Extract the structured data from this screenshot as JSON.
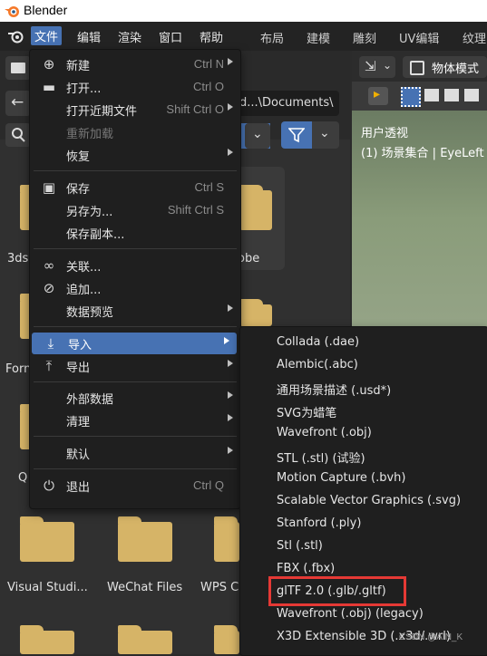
{
  "window": {
    "title": "Blender"
  },
  "menubar": {
    "items": [
      "文件",
      "编辑",
      "渲染",
      "窗口",
      "帮助"
    ],
    "workspaces": [
      "布局",
      "建模",
      "雕刻",
      "UV编辑",
      "纹理"
    ]
  },
  "file_browser": {
    "path": "d...\\Documents\\",
    "items": [
      {
        "label": "3ds"
      },
      {
        "label": "obe"
      },
      {
        "label": "Forn"
      },
      {
        "label": "Q"
      },
      {
        "label": "Visual Studi..."
      },
      {
        "label": "WeChat Files"
      },
      {
        "label": "WPS C"
      }
    ]
  },
  "viewport": {
    "mode": "物体模式",
    "view_label": "用户透视",
    "collection_label": "(1) 场景集合 | EyeLeft"
  },
  "file_menu": {
    "items": [
      {
        "label": "新建",
        "shortcut": "Ctrl N",
        "icon": "new-file-icon",
        "submenu": true
      },
      {
        "label": "打开...",
        "shortcut": "Ctrl O",
        "icon": "folder-icon",
        "submenu": false
      },
      {
        "label": "打开近期文件",
        "shortcut": "Shift Ctrl O",
        "icon": "",
        "submenu": true
      },
      {
        "label": "重新加载",
        "shortcut": "",
        "icon": "",
        "submenu": false,
        "disabled": true
      },
      {
        "label": "恢复",
        "shortcut": "",
        "icon": "",
        "submenu": true
      },
      {
        "label": "保存",
        "shortcut": "Ctrl S",
        "icon": "save-icon",
        "submenu": false
      },
      {
        "label": "另存为...",
        "shortcut": "Shift Ctrl S",
        "icon": "",
        "submenu": false
      },
      {
        "label": "保存副本...",
        "shortcut": "",
        "icon": "",
        "submenu": false
      },
      {
        "label": "关联...",
        "shortcut": "",
        "icon": "link-icon",
        "submenu": false
      },
      {
        "label": "追加...",
        "shortcut": "",
        "icon": "append-icon",
        "submenu": false
      },
      {
        "label": "数据预览",
        "shortcut": "",
        "icon": "",
        "submenu": true
      },
      {
        "label": "导入",
        "shortcut": "",
        "icon": "import-icon",
        "submenu": true,
        "active": true
      },
      {
        "label": "导出",
        "shortcut": "",
        "icon": "export-icon",
        "submenu": true
      },
      {
        "label": "外部数据",
        "shortcut": "",
        "icon": "",
        "submenu": true
      },
      {
        "label": "清理",
        "shortcut": "",
        "icon": "",
        "submenu": true
      },
      {
        "label": "默认",
        "shortcut": "",
        "icon": "",
        "submenu": true
      },
      {
        "label": "退出",
        "shortcut": "Ctrl Q",
        "icon": "power-icon",
        "submenu": false
      }
    ]
  },
  "import_menu": {
    "items": [
      "Collada (.dae)",
      "Alembic(.abc)",
      "通用场景描述 (.usd*)",
      "SVG为蜡笔",
      "Wavefront (.obj)",
      "STL (.stl) (试验)",
      "Motion Capture (.bvh)",
      "Scalable Vector Graphics (.svg)",
      "Stanford (.ply)",
      "Stl (.stl)",
      "FBX (.fbx)",
      "glTF 2.0 (.glb/.gltf)",
      "Wavefront (.obj) (legacy)",
      "X3D Extensible 3D (.x3d/.wrl)"
    ],
    "highlighted": "glTF 2.0 (.glb/.gltf)"
  },
  "watermark": "CSDN @AIN_K",
  "colors": {
    "accent": "#4772b3",
    "highlight_box": "#e53935",
    "folder": "#d6b467"
  }
}
